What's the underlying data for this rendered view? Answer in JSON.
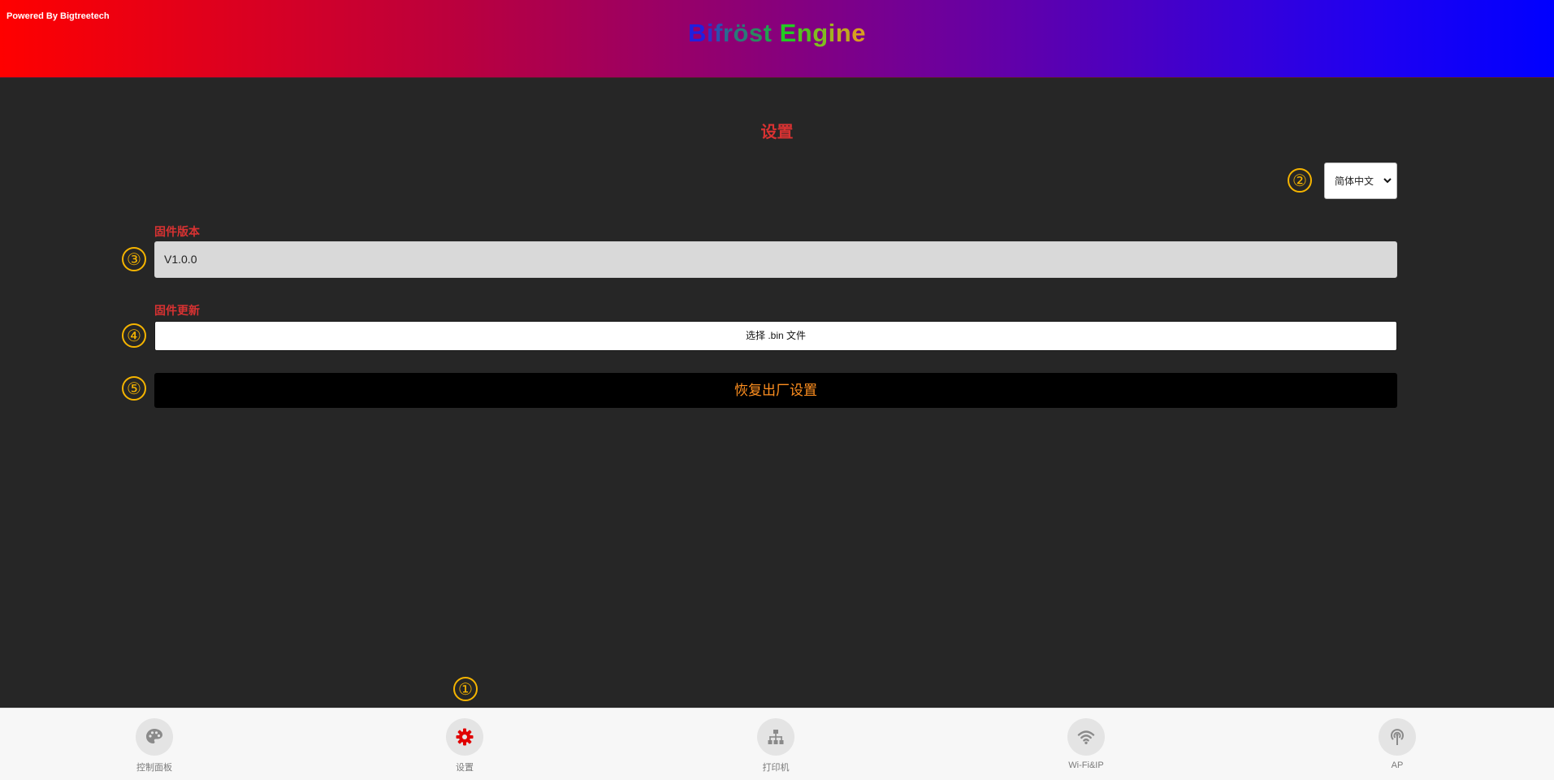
{
  "header": {
    "powered_by": "Powered By Bigtreetech",
    "brand_letters": [
      {
        "ch": "B",
        "color": "#2020e0"
      },
      {
        "ch": "i",
        "color": "#3030c8"
      },
      {
        "ch": "f",
        "color": "#2a50b0"
      },
      {
        "ch": "r",
        "color": "#2a6a90"
      },
      {
        "ch": "ö",
        "color": "#2a7a78"
      },
      {
        "ch": "s",
        "color": "#2a8a60"
      },
      {
        "ch": "t",
        "color": "#22a050"
      },
      {
        "ch": " ",
        "color": "#22a050"
      },
      {
        "ch": "E",
        "color": "#22cc22"
      },
      {
        "ch": "n",
        "color": "#55c020"
      },
      {
        "ch": "g",
        "color": "#80bd20"
      },
      {
        "ch": "i",
        "color": "#a0b420"
      },
      {
        "ch": "n",
        "color": "#c0a820"
      },
      {
        "ch": "e",
        "color": "#d8a020"
      }
    ]
  },
  "main": {
    "title": "设置",
    "language_select": {
      "value": "简体中文"
    },
    "firmware_version": {
      "label": "固件版本",
      "value": "V1.0.0"
    },
    "firmware_update": {
      "label": "固件更新",
      "button": "选择 .bin 文件"
    },
    "factory_reset": {
      "button": "恢复出厂设置"
    }
  },
  "annotations": [
    "①",
    "②",
    "③",
    "④",
    "⑤"
  ],
  "nav": [
    {
      "label": "控制面板",
      "icon": "palette-icon",
      "active": false
    },
    {
      "label": "设置",
      "icon": "gear-icon",
      "active": true
    },
    {
      "label": "打印机",
      "icon": "sitemap-icon",
      "active": false
    },
    {
      "label": "Wi-Fi&IP",
      "icon": "wifi-icon",
      "active": false
    },
    {
      "label": "AP",
      "icon": "broadcast-tower-icon",
      "active": false
    }
  ],
  "colors": {
    "accent_red": "#d83232",
    "reset_text": "#ff8f1f",
    "annotation": "#f5b400",
    "nav_active_icon": "#e00000",
    "nav_icon": "#8a8a8a"
  }
}
